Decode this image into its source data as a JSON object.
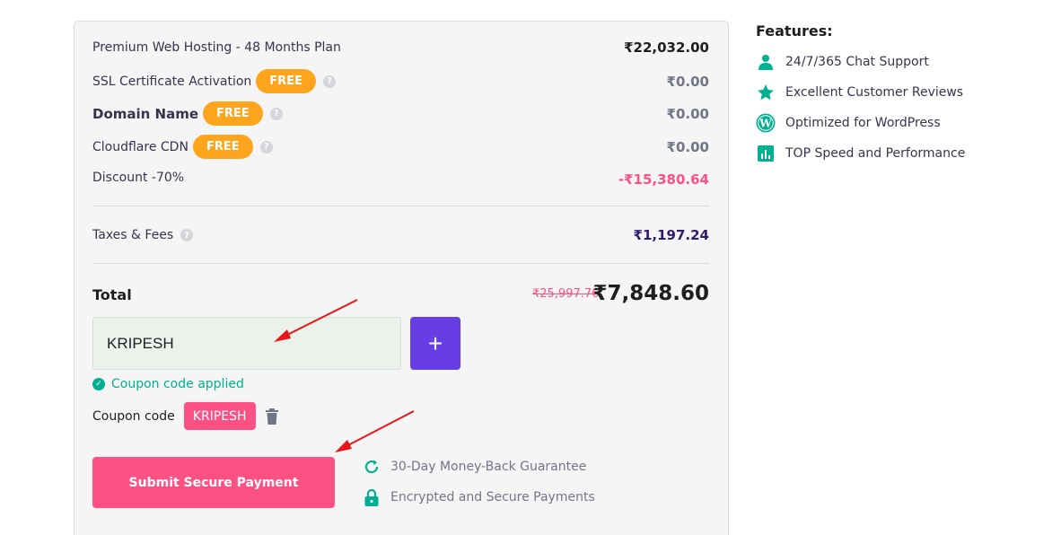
{
  "order": {
    "plan_label": "Premium Web Hosting - 48 Months Plan",
    "plan_price": "₹22,032.00",
    "ssl_label": "SSL Certificate Activation",
    "ssl_badge": "FREE",
    "ssl_price": "₹0.00",
    "domain_label": "Domain Name",
    "domain_badge": "FREE",
    "domain_price": "₹0.00",
    "cdn_label": "Cloudflare CDN",
    "cdn_badge": "FREE",
    "cdn_price": "₹0.00",
    "discount_label": "Discount -70%",
    "discount_price": "-₹15,380.64",
    "taxes_label": "Taxes & Fees",
    "taxes_price": "₹1,197.24",
    "total_label": "Total",
    "total_old": "₹25,997.76",
    "total_new": "₹7,848.60"
  },
  "coupon": {
    "input_value": "KRIPESH",
    "add_label": "+",
    "applied_text": "Coupon code applied",
    "code_label": "Coupon code",
    "code_value": "KRIPESH"
  },
  "payment": {
    "submit_label": "Submit Secure Payment",
    "guarantee": "30-Day Money-Back Guarantee",
    "secure": "Encrypted and Secure Payments"
  },
  "features": {
    "title": "Features:",
    "items": [
      {
        "label": "24/7/365 Chat Support",
        "icon": "person-icon"
      },
      {
        "label": "Excellent Customer Reviews",
        "icon": "star-icon"
      },
      {
        "label": "Optimized for WordPress",
        "icon": "wordpress-icon"
      },
      {
        "label": "TOP Speed and Performance",
        "icon": "bar-chart-icon"
      }
    ]
  },
  "colors": {
    "accent_purple": "#673de6",
    "pink": "#fc5185",
    "orange": "#ffa41d",
    "green": "#00b090"
  }
}
